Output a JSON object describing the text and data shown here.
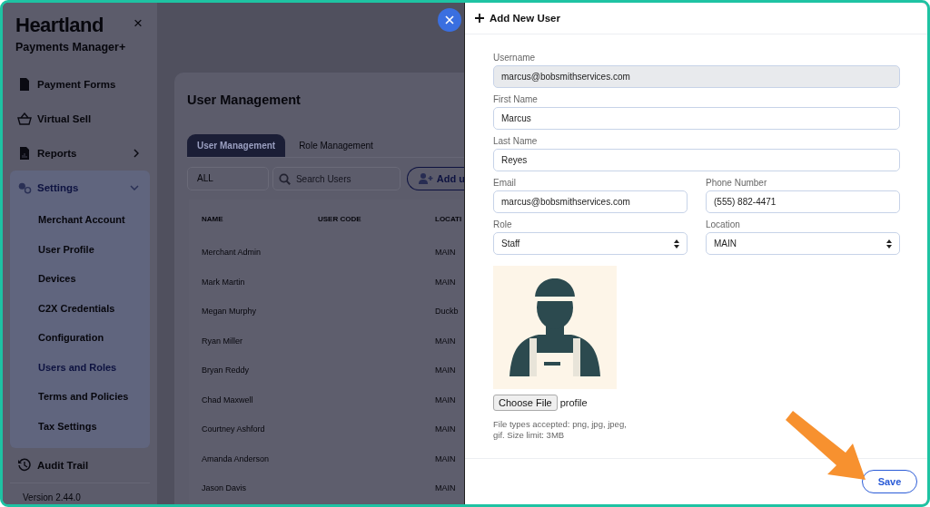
{
  "sidebar": {
    "brand": "Heartland",
    "product": "Payments Manager+",
    "close": "×",
    "items": [
      {
        "label": "Payment Forms",
        "kind": "link",
        "selected": false
      },
      {
        "label": "Virtual Sell",
        "kind": "link",
        "selected": false
      },
      {
        "label": "Reports",
        "kind": "group",
        "expanded": false,
        "selected": false
      },
      {
        "label": "Settings",
        "kind": "group",
        "expanded": true,
        "selected": true,
        "children": [
          {
            "label": "Merchant Account",
            "selected": false
          },
          {
            "label": "User Profile",
            "selected": false
          },
          {
            "label": "Devices",
            "selected": false
          },
          {
            "label": "C2X Credentials",
            "selected": false
          },
          {
            "label": "Configuration",
            "selected": false
          },
          {
            "label": "Users and Roles",
            "selected": true
          },
          {
            "label": "Terms and Policies",
            "selected": false
          },
          {
            "label": "Tax Settings",
            "selected": false
          }
        ]
      },
      {
        "label": "Audit Trail",
        "kind": "link",
        "selected": false
      }
    ],
    "version": "Version 2.44.0"
  },
  "page": {
    "title": "User Management",
    "tabs": [
      {
        "label": "User Management",
        "selected": true
      },
      {
        "label": "Role Management",
        "selected": false
      }
    ],
    "filter": {
      "value": "ALL"
    },
    "search": {
      "placeholder": "Search Users"
    },
    "add_button": "Add u",
    "table": {
      "columns": [
        "NAME",
        "USER CODE",
        "LOCATI"
      ],
      "rows": [
        {
          "name": "Merchant Admin",
          "location": "MAIN"
        },
        {
          "name": "Mark Martin",
          "location": "MAIN"
        },
        {
          "name": "Megan Murphy",
          "location": "Duckb"
        },
        {
          "name": "Ryan Miller",
          "location": "MAIN"
        },
        {
          "name": "Bryan Reddy",
          "location": "MAIN"
        },
        {
          "name": "Chad Maxwell",
          "location": "MAIN"
        },
        {
          "name": "Courtney Ashford",
          "location": "MAIN"
        },
        {
          "name": "Amanda Anderson",
          "location": "MAIN"
        },
        {
          "name": "Jason Davis",
          "location": "MAIN"
        }
      ]
    }
  },
  "drawer": {
    "title": "Add New User",
    "field_rows": [
      [
        {
          "label": "Username",
          "value": "marcus@bobsmithservices.com",
          "kind": "text",
          "disabled": true
        }
      ],
      [
        {
          "label": "First Name",
          "value": "Marcus",
          "kind": "text",
          "disabled": false
        }
      ],
      [
        {
          "label": "Last Name",
          "value": "Reyes",
          "kind": "text",
          "disabled": false
        }
      ],
      [
        {
          "label": "Email",
          "value": "marcus@bobsmithservices.com",
          "kind": "text",
          "disabled": false
        },
        {
          "label": "Phone Number",
          "value": "(555) 882-4471",
          "kind": "text",
          "disabled": false
        }
      ],
      [
        {
          "label": "Role",
          "value": "Staff",
          "kind": "select",
          "disabled": false
        },
        {
          "label": "Location",
          "value": "MAIN",
          "kind": "select",
          "disabled": false
        }
      ]
    ],
    "photo": {
      "kind": "picture"
    },
    "file": {
      "button": "Choose File",
      "name": "profile",
      "hint": "File types accepted: png, jpg, jpeg, gif. Size limit: 3MB"
    },
    "save": "Save",
    "callout": true
  }
}
